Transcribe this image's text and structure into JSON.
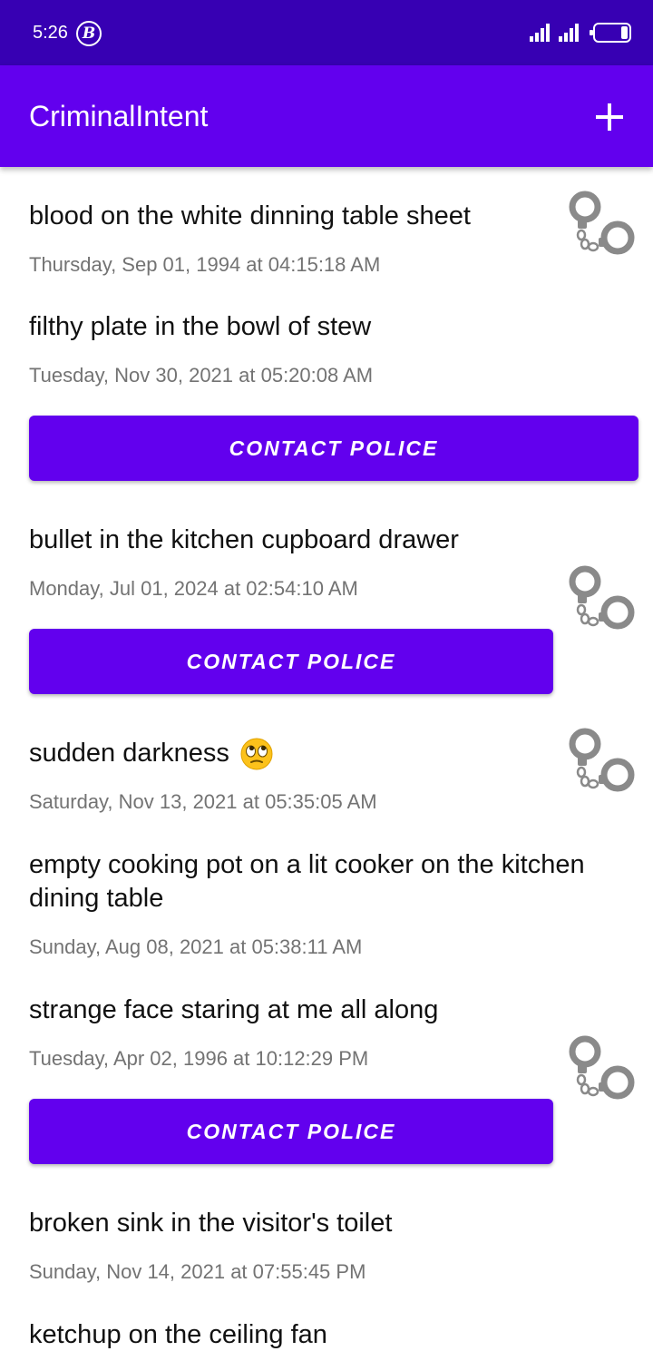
{
  "status_bar": {
    "time": "5:26",
    "bitcoin_symbol": "B",
    "icons": [
      "bitcoin-icon",
      "signal-icon",
      "signal-icon",
      "battery-icon"
    ]
  },
  "app_bar": {
    "title": "CriminalIntent",
    "add_icon": "add-icon",
    "color": "#6200ee"
  },
  "crimes": [
    {
      "title": "blood on the white dinning table sheet",
      "date": "Thursday, Sep 01, 1994 at 04:15:18 AM",
      "solved": true
    },
    {
      "title": "filthy plate in the bowl of stew",
      "date": "Tuesday, Nov 30, 2021 at 05:20:08 AM",
      "button": "CONTACT POLICE"
    },
    {
      "title": "bullet in the kitchen cupboard drawer",
      "date": "Monday, Jul 01, 2024 at 02:54:10 AM",
      "button": "CONTACT POLICE",
      "solved": true
    },
    {
      "title": "sudden darkness",
      "date": "Saturday, Nov 13, 2021 at 05:35:05 AM",
      "solved": true,
      "emoji": "face-with-rolling-eyes"
    },
    {
      "title_line1": "empty cooking pot on a lit cooker on the kitchen",
      "title_line2": "dining table",
      "date": "Sunday, Aug 08, 2021 at 05:38:11 AM"
    },
    {
      "title": "strange face staring at me all along",
      "date": "Tuesday, Apr 02, 1996 at 10:12:29 PM",
      "button": "CONTACT POLICE",
      "solved": true
    },
    {
      "title": "broken sink in the visitor's toilet",
      "date": "Sunday, Nov 14, 2021 at 07:55:45 PM"
    },
    {
      "title": "ketchup on the ceiling fan"
    }
  ],
  "colors": {
    "status_bar": "#3700b3",
    "accent": "#6200ee",
    "date_text": "#737373",
    "icon_gray": "#8a8a8a"
  }
}
